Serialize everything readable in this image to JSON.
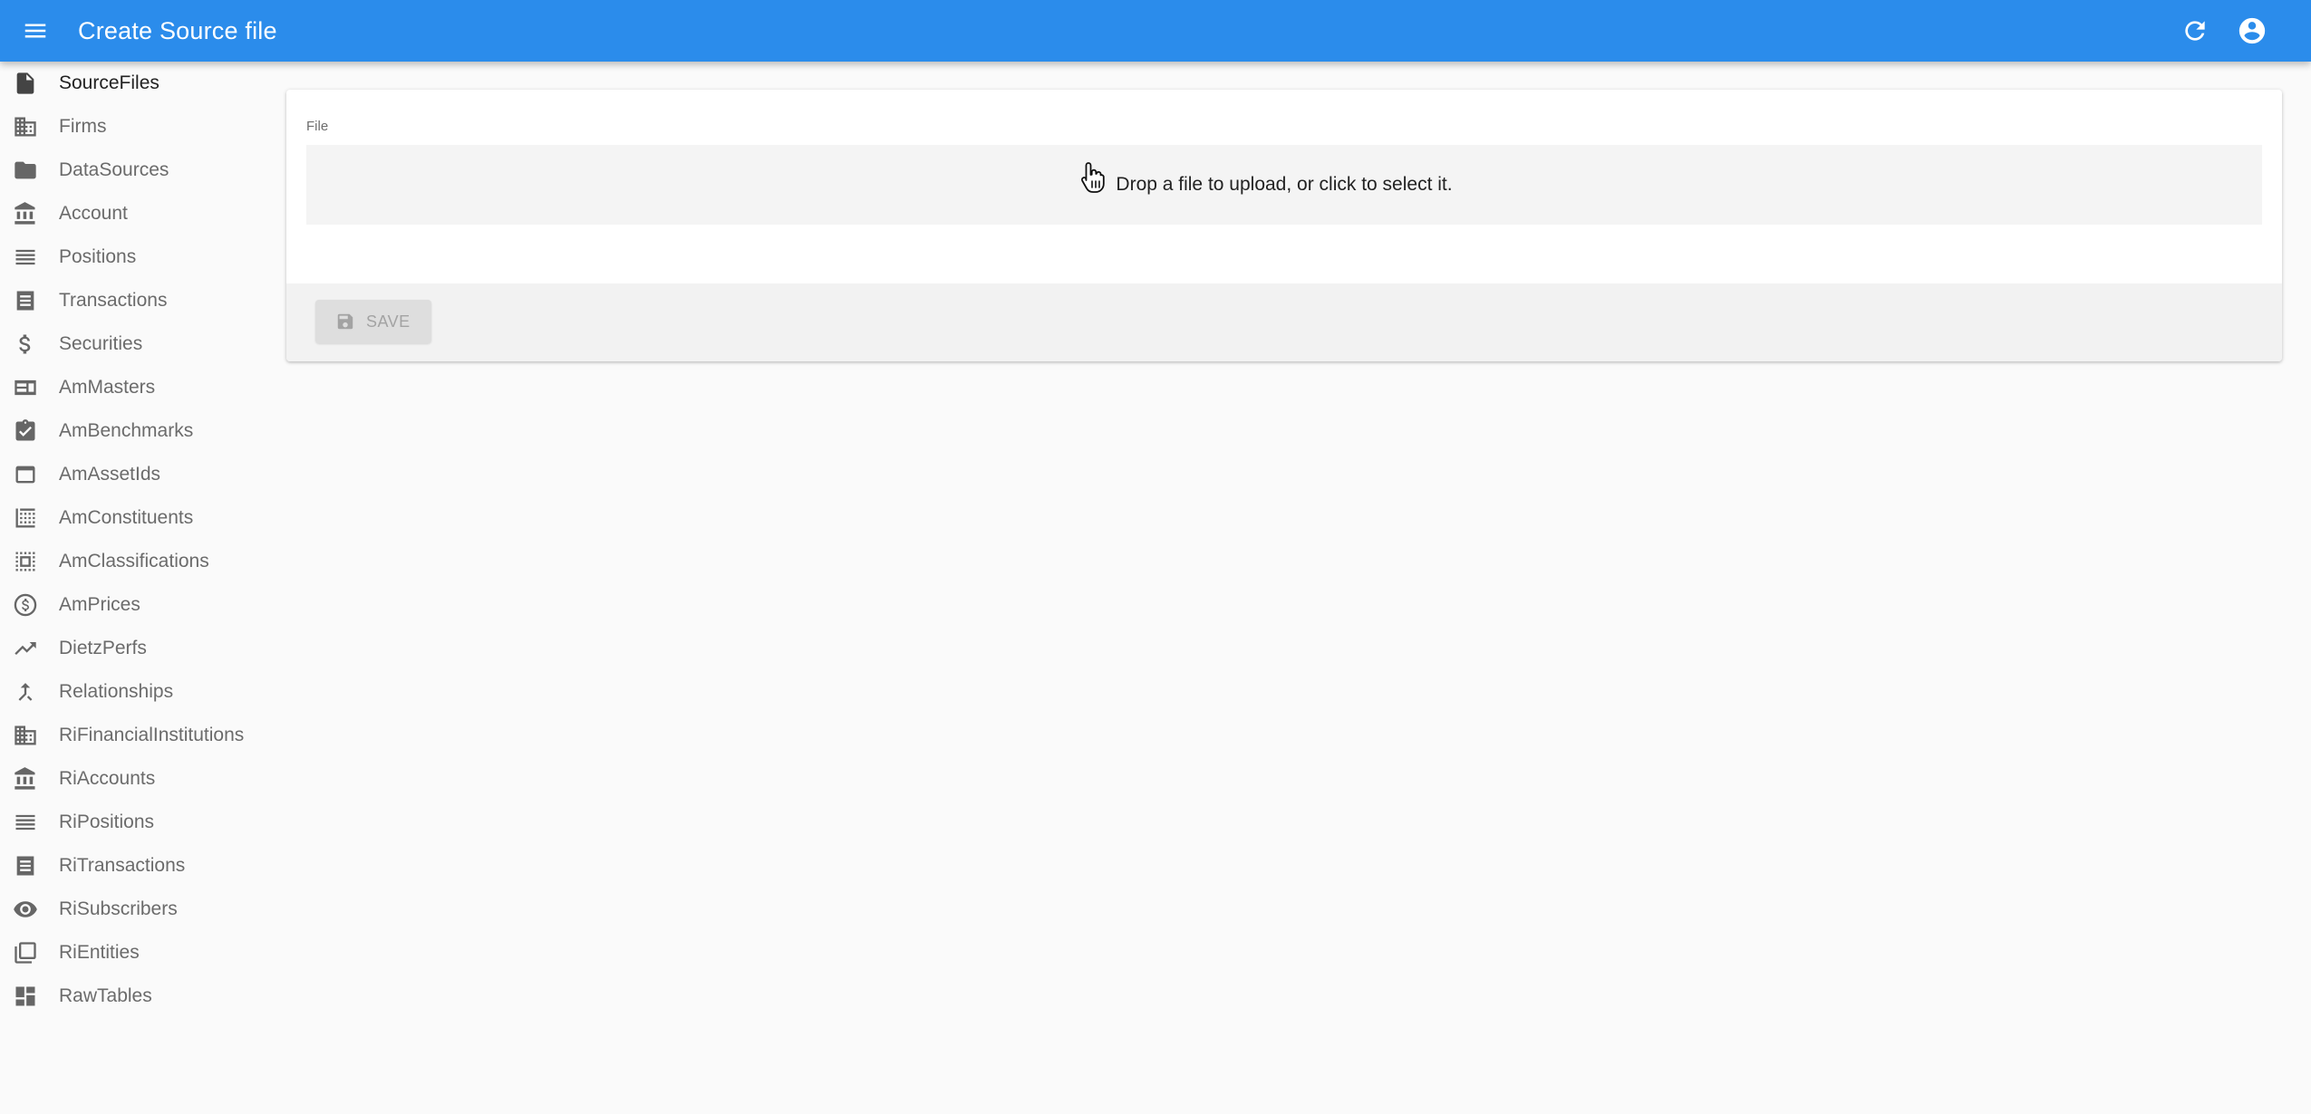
{
  "appbar": {
    "title": "Create Source file",
    "menu_icon": "menu-icon",
    "refresh_icon": "refresh-icon",
    "account_icon": "account-circle-icon",
    "color": "#2b8ceb"
  },
  "sidebar": {
    "items": [
      {
        "label": "SourceFiles",
        "icon": "file-icon",
        "active": true
      },
      {
        "label": "Firms",
        "icon": "domain-icon"
      },
      {
        "label": "DataSources",
        "icon": "folder-icon"
      },
      {
        "label": "Account",
        "icon": "bank-icon"
      },
      {
        "label": "Positions",
        "icon": "list-icon"
      },
      {
        "label": "Transactions",
        "icon": "receipt-list-icon"
      },
      {
        "label": "Securities",
        "icon": "dollar-icon"
      },
      {
        "label": "AmMasters",
        "icon": "featured-card-icon"
      },
      {
        "label": "AmBenchmarks",
        "icon": "assignment-check-icon"
      },
      {
        "label": "AmAssetIds",
        "icon": "web-asset-icon"
      },
      {
        "label": "AmConstituents",
        "icon": "border-clear-icon"
      },
      {
        "label": "AmClassifications",
        "icon": "select-all-icon"
      },
      {
        "label": "AmPrices",
        "icon": "monetization-icon"
      },
      {
        "label": "DietzPerfs",
        "icon": "trending-up-icon"
      },
      {
        "label": "Relationships",
        "icon": "merge-icon"
      },
      {
        "label": "RiFinancialInstitutions",
        "icon": "domain-icon"
      },
      {
        "label": "RiAccounts",
        "icon": "bank-icon"
      },
      {
        "label": "RiPositions",
        "icon": "list-icon"
      },
      {
        "label": "RiTransactions",
        "icon": "receipt-list-icon"
      },
      {
        "label": "RiSubscribers",
        "icon": "eye-icon"
      },
      {
        "label": "RiEntities",
        "icon": "library-books-icon"
      },
      {
        "label": "RawTables",
        "icon": "dashboard-icon"
      }
    ]
  },
  "form": {
    "field_label": "File",
    "dropzone_text": "Drop a file to upload, or click to select it.",
    "save_label": "SAVE",
    "save_icon": "save-icon"
  }
}
